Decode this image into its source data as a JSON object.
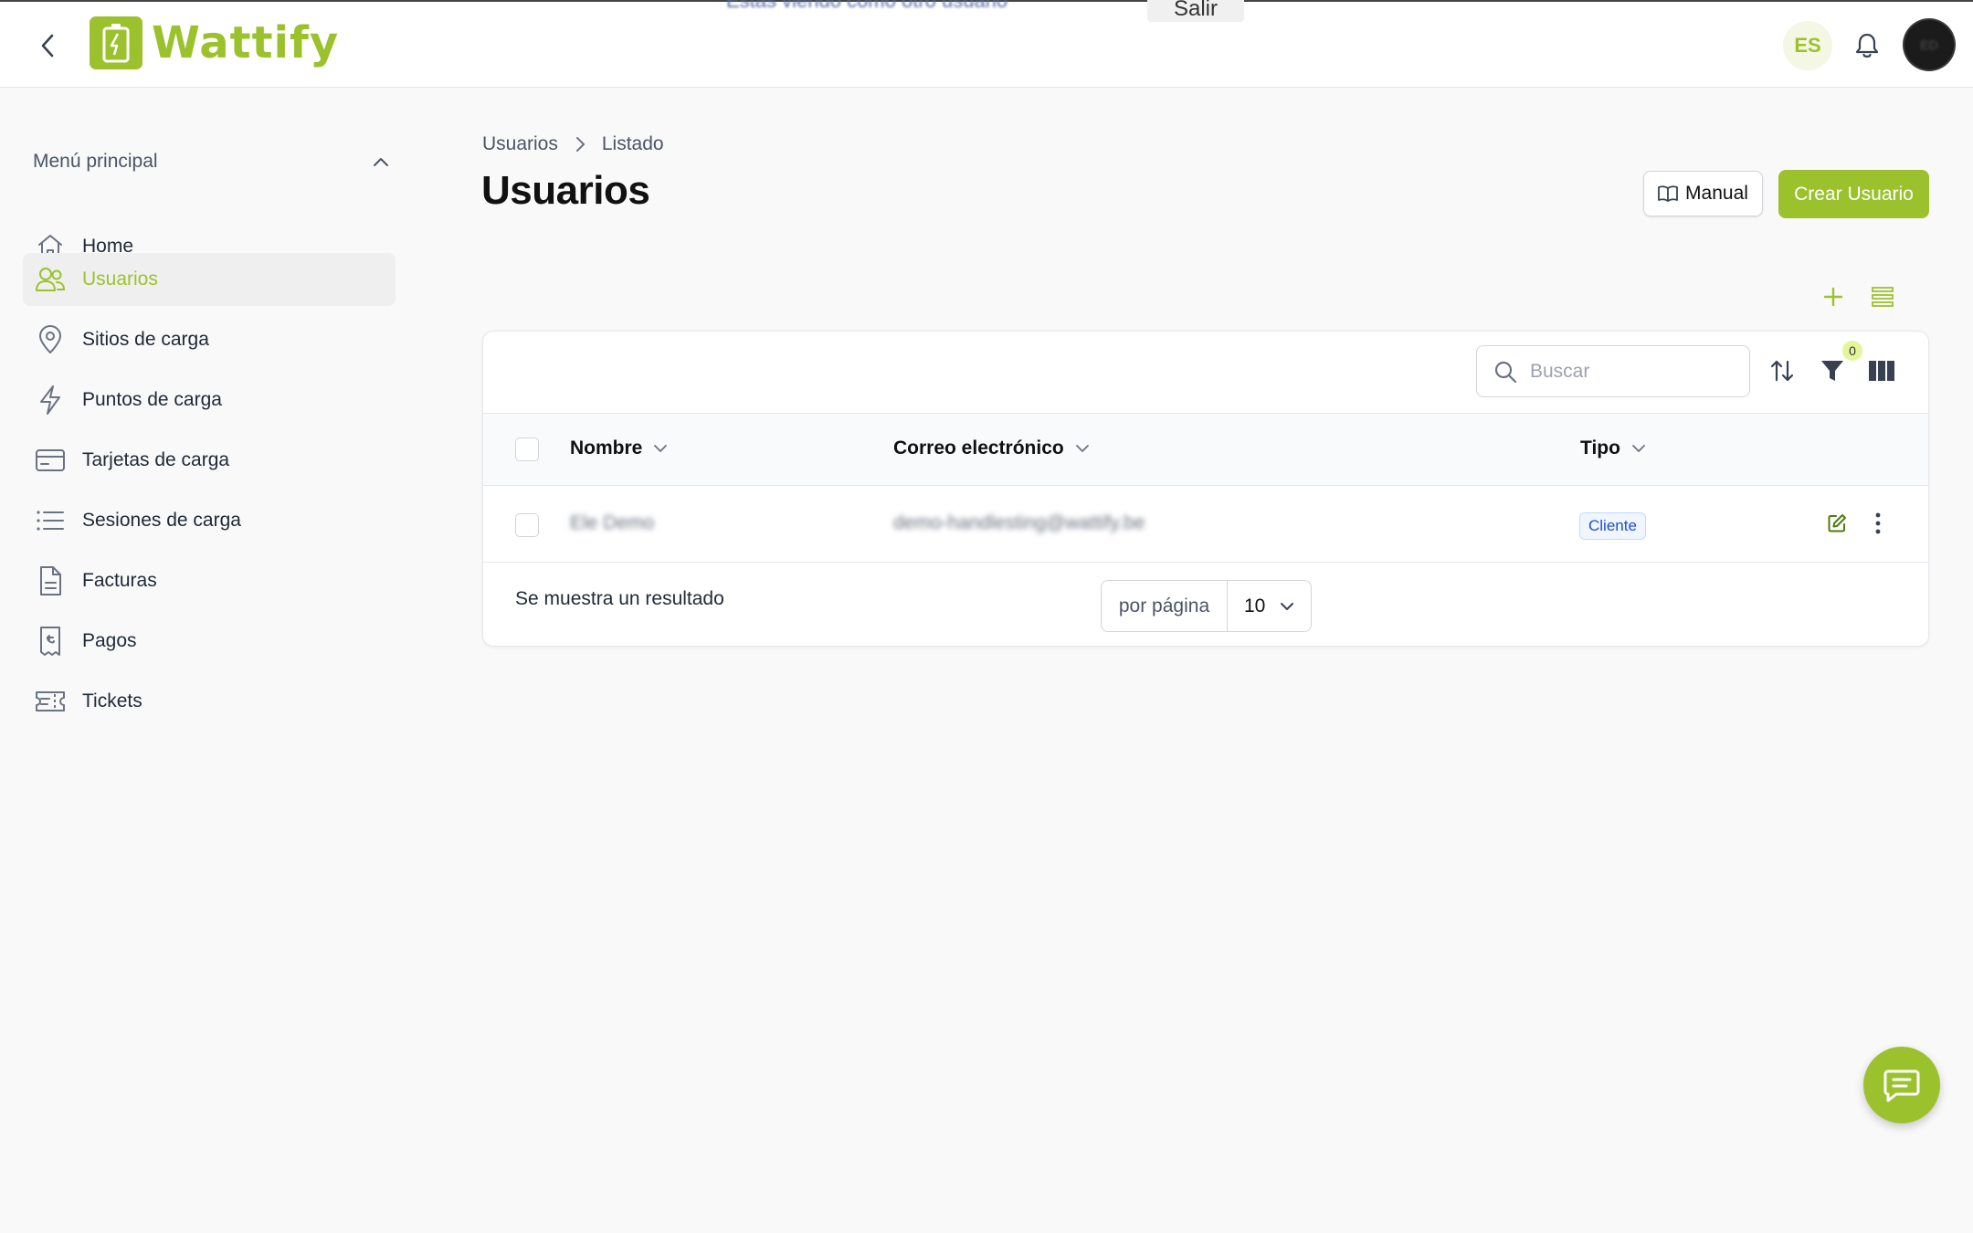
{
  "header": {
    "logo_text": "Wattify",
    "top_center_text": "Estás viendo como otro usuario",
    "top_center_button": "Salir",
    "language": "ES",
    "avatar_initials": "ED"
  },
  "sidebar": {
    "menu_title": "Menú principal",
    "items": [
      {
        "label": "Home",
        "icon": "home-icon"
      },
      {
        "label": "Usuarios",
        "icon": "users-icon",
        "active": true
      },
      {
        "label": "Sitios de carga",
        "icon": "map-pin-icon"
      },
      {
        "label": "Puntos de carga",
        "icon": "lightning-icon"
      },
      {
        "label": "Tarjetas de carga",
        "icon": "card-icon"
      },
      {
        "label": "Sesiones de carga",
        "icon": "list-icon"
      },
      {
        "label": "Facturas",
        "icon": "document-icon"
      },
      {
        "label": "Pagos",
        "icon": "receipt-icon"
      },
      {
        "label": "Tickets",
        "icon": "ticket-icon"
      }
    ]
  },
  "breadcrumb": {
    "level1": "Usuarios",
    "level2": "Listado"
  },
  "page": {
    "title": "Usuarios",
    "manual_label": "Manual",
    "create_label": "Crear Usuario"
  },
  "table": {
    "search_placeholder": "Buscar",
    "filter_count": "0",
    "columns": {
      "name": "Nombre",
      "email": "Correo electrónico",
      "type": "Tipo"
    },
    "rows": [
      {
        "name": "Ele Demo",
        "email": "demo-handlesting@wattify.be",
        "type": "Cliente"
      }
    ],
    "result_text": "Se muestra un resultado",
    "per_page_label": "por página",
    "per_page_value": "10"
  },
  "colors": {
    "brand": "#9bc22d",
    "badge_blue": "#1d4ed8",
    "filter_badge": "#e4f59a"
  }
}
